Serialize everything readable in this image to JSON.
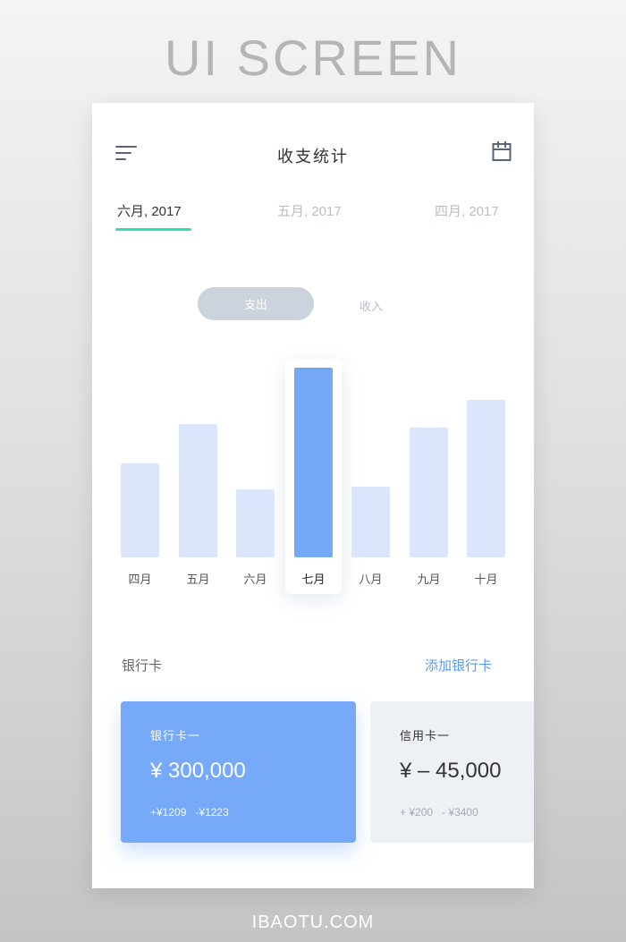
{
  "poster": {
    "title": "UI SCREEN",
    "footer": "IBAOTU.COM"
  },
  "header": {
    "title": "收支统计",
    "menu_icon": "menu-lines-icon",
    "calendar_icon": "calendar-icon"
  },
  "month_tabs": [
    {
      "label": "六月, 2017",
      "active": true
    },
    {
      "label": "五月, 2017",
      "active": false
    },
    {
      "label": "四月, 2017",
      "active": false
    }
  ],
  "toggle": {
    "expense_label": "支出",
    "income_label": "收入",
    "selected": "支出"
  },
  "chart_data": {
    "type": "bar",
    "categories": [
      "四月",
      "五月",
      "六月",
      "七月",
      "八月",
      "九月",
      "十月"
    ],
    "values": [
      105,
      149,
      76,
      212,
      79,
      145,
      176
    ],
    "highlighted": "七月",
    "colors": {
      "default": "#d9e6fb",
      "highlight": "#75a9f7"
    }
  },
  "bank_section": {
    "title": "银行卡",
    "add_label": "添加银行卡"
  },
  "cards": [
    {
      "name": "银行卡一",
      "amount": "¥ 300,000",
      "inflow": "+¥1209",
      "outflow": "-¥1223"
    },
    {
      "name": "信用卡一",
      "amount": "¥ – 45,000",
      "inflow": "+ ¥200",
      "outflow": "- ¥3400"
    }
  ],
  "colors": {
    "accent_underline": "#2de0b4",
    "primary_blue": "#75a9f7",
    "link_blue": "#5b9af5"
  }
}
